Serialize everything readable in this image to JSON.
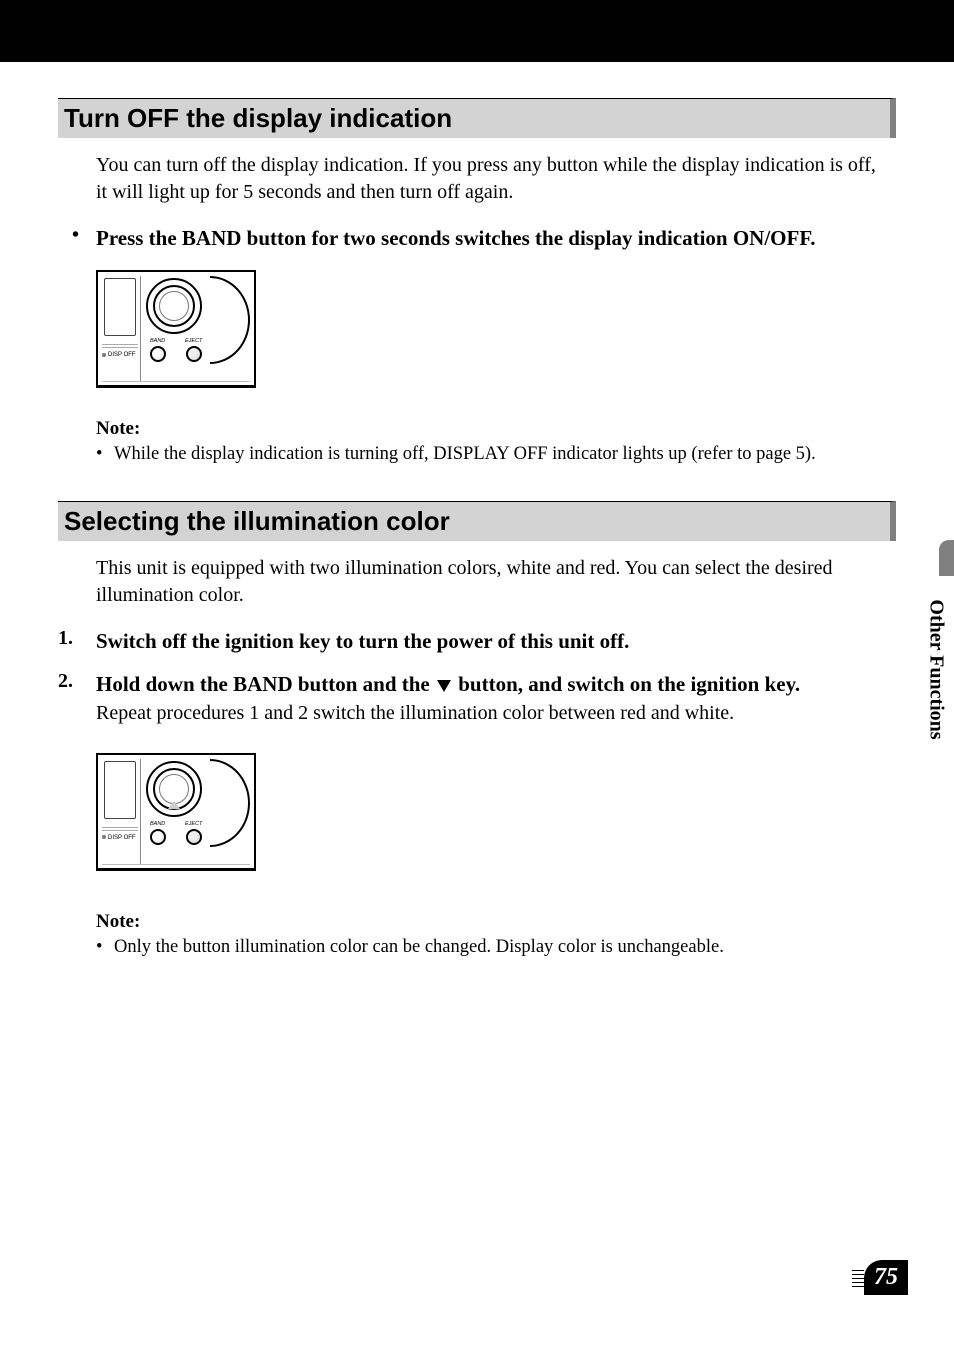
{
  "section1": {
    "heading": "Turn OFF the display indication",
    "intro": "You can turn off the display indication. If you press any button while the display indication is off, it will light up for 5 seconds and then turn off again.",
    "bullet_marker": "•",
    "bullet_text": "Press the BAND button for two seconds switches the display indication ON/OFF.",
    "note_heading": "Note:",
    "note_marker": "•",
    "note_text": "While the display indication is turning off, DISPLAY OFF indicator lights up (refer to page 5)."
  },
  "section2": {
    "heading": "Selecting the illumination color",
    "intro": "This unit is equipped with two illumination colors, white and red. You can select the desired illumination color.",
    "step1_marker": "1.",
    "step1_text": "Switch off the ignition key to turn the power of this unit off.",
    "step2_marker": "2.",
    "step2_text_a": "Hold down the BAND button and the ",
    "step2_text_b": " button, and switch on the ignition key.",
    "step2_sub": "Repeat procedures 1 and 2 switch the illumination color between red and white.",
    "note_heading": "Note:",
    "note_marker": "•",
    "note_text": "Only the button illumination color can be changed. Display color is unchangeable."
  },
  "figure": {
    "disp_off": "DISP OFF",
    "band": "BAND",
    "eject": "EJECT"
  },
  "side_tab": "Other Functions",
  "page_number": "75"
}
